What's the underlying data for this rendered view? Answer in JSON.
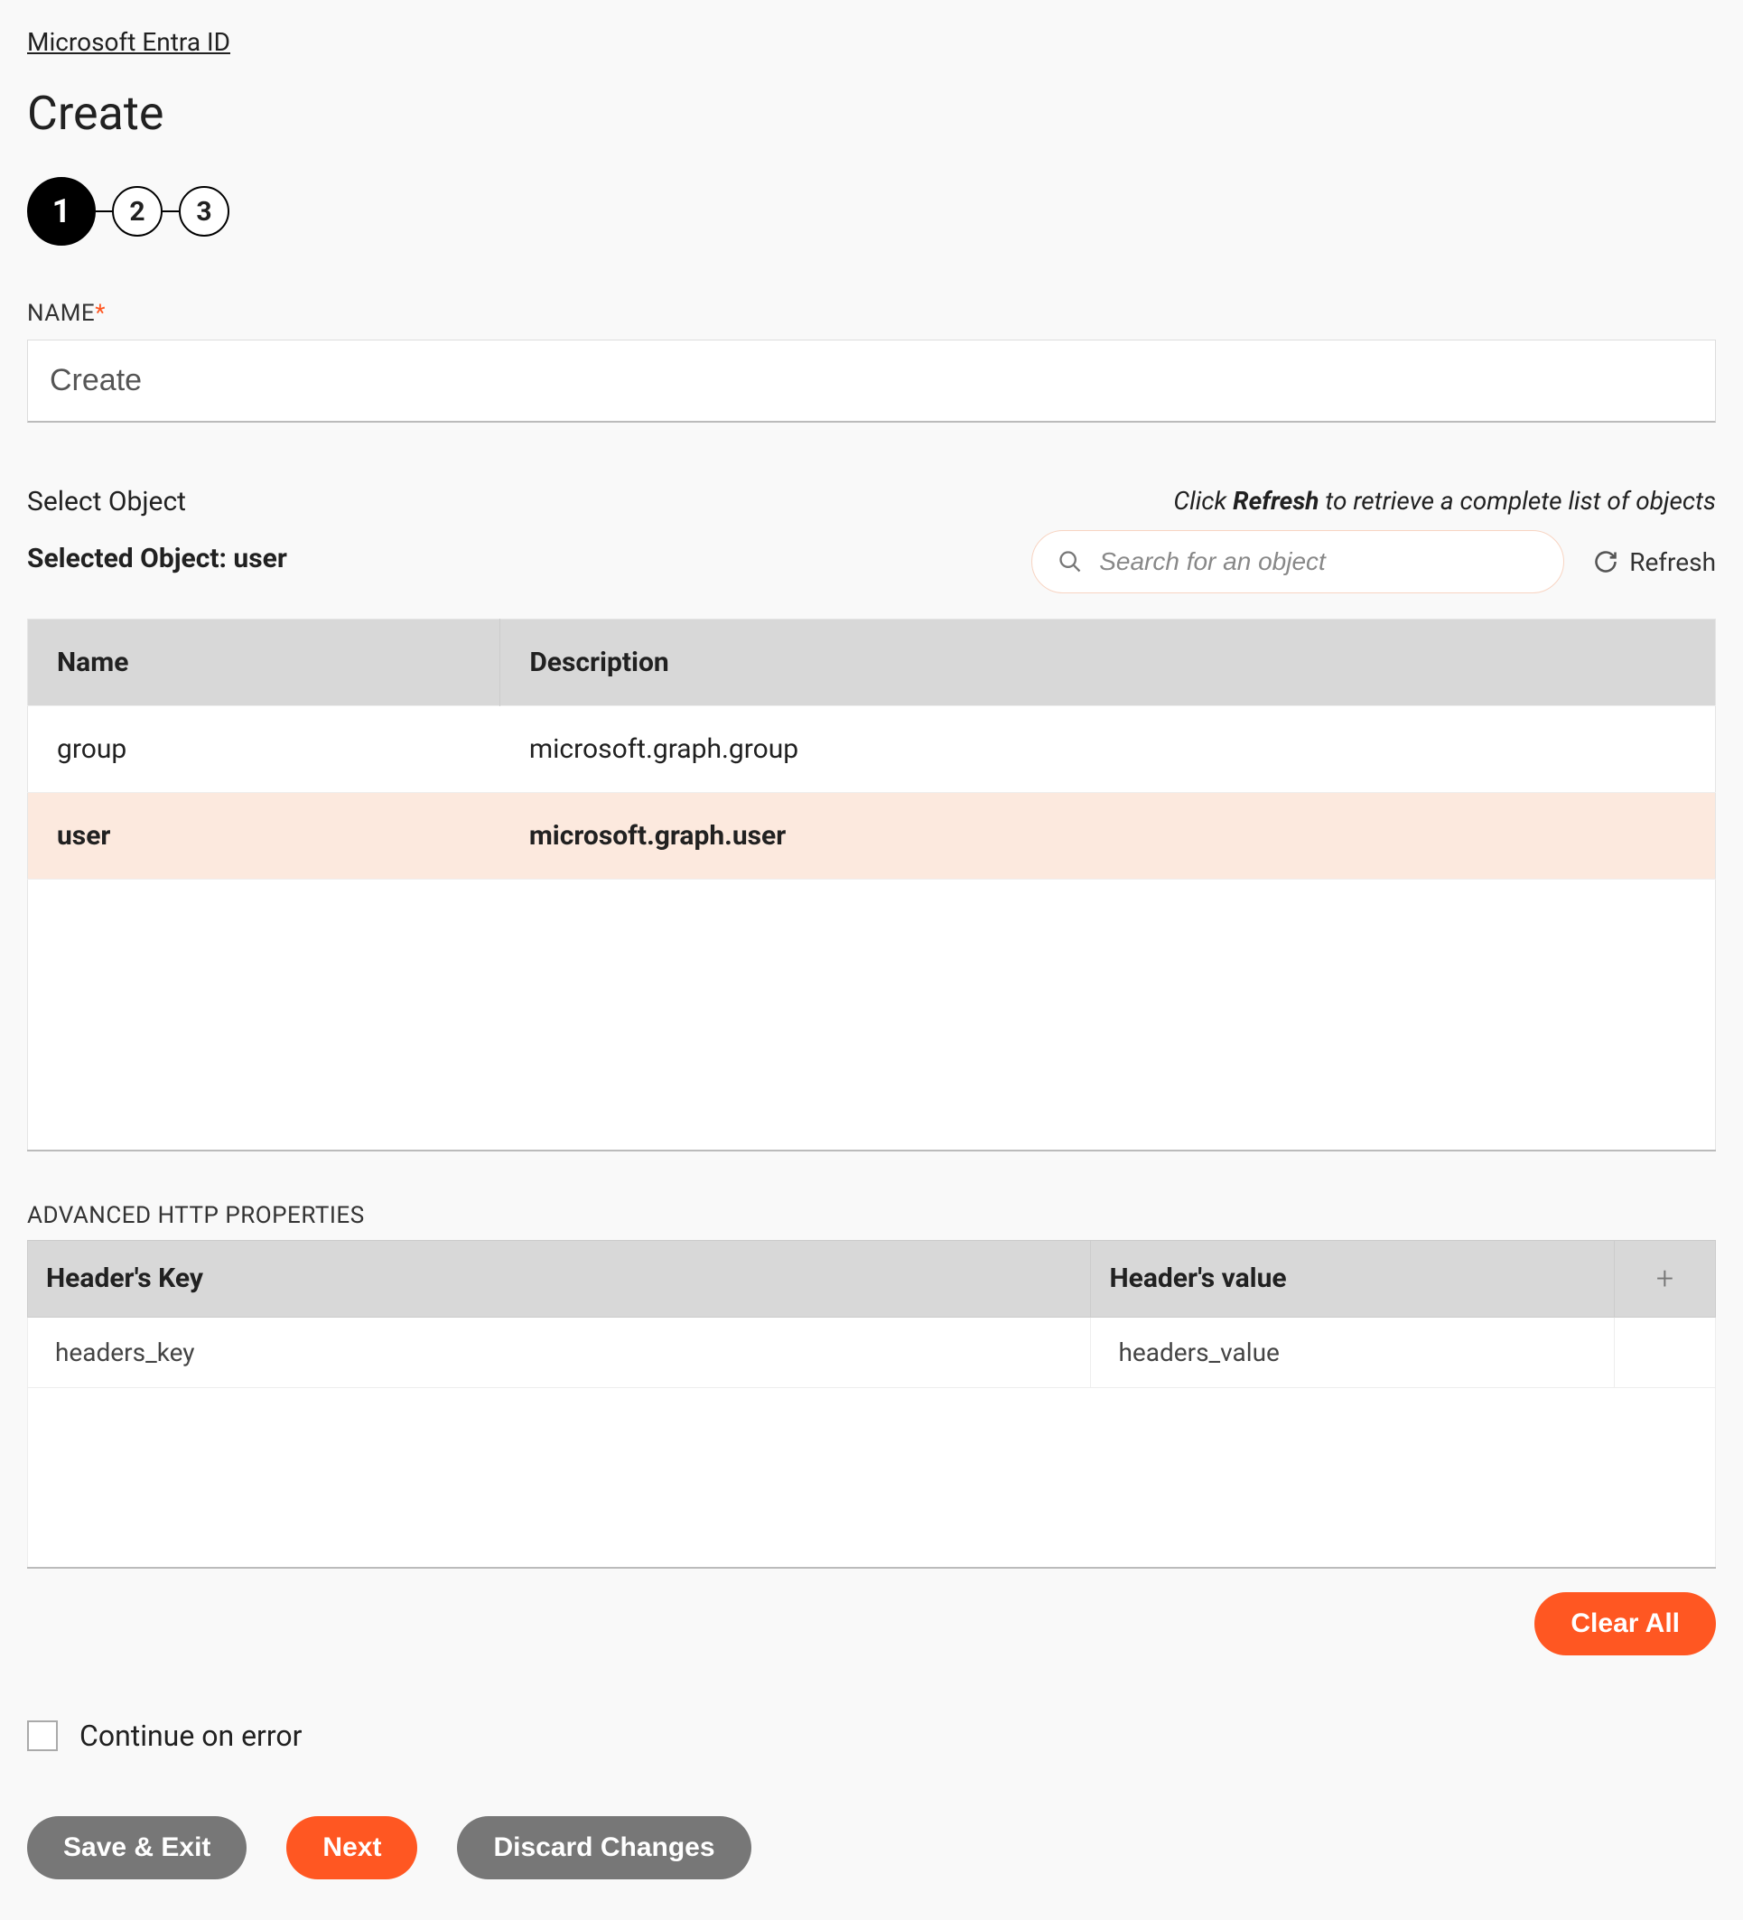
{
  "breadcrumb": "Microsoft Entra ID",
  "page_title": "Create",
  "stepper": {
    "s1": "1",
    "s2": "2",
    "s3": "3"
  },
  "name_field": {
    "label": "NAME",
    "value": "Create"
  },
  "select_object": {
    "label": "Select Object",
    "selected_prefix": "Selected Object: ",
    "selected_value": "user",
    "hint_prefix": "Click ",
    "hint_bold": "Refresh",
    "hint_suffix": " to retrieve a complete list of objects",
    "search_placeholder": "Search for an object",
    "refresh_label": "Refresh"
  },
  "objects_table": {
    "header_name": "Name",
    "header_desc": "Description",
    "rows": [
      {
        "name": "group",
        "desc": "microsoft.graph.group",
        "selected": false
      },
      {
        "name": "user",
        "desc": "microsoft.graph.user",
        "selected": true
      }
    ]
  },
  "advanced": {
    "label": "ADVANCED HTTP PROPERTIES",
    "header_key": "Header's Key",
    "header_value": "Header's value",
    "rows": [
      {
        "key": "headers_key",
        "value": "headers_value"
      }
    ]
  },
  "buttons": {
    "clear_all": "Clear All",
    "save_exit": "Save & Exit",
    "next": "Next",
    "discard": "Discard Changes"
  },
  "continue_on_error": "Continue on error"
}
